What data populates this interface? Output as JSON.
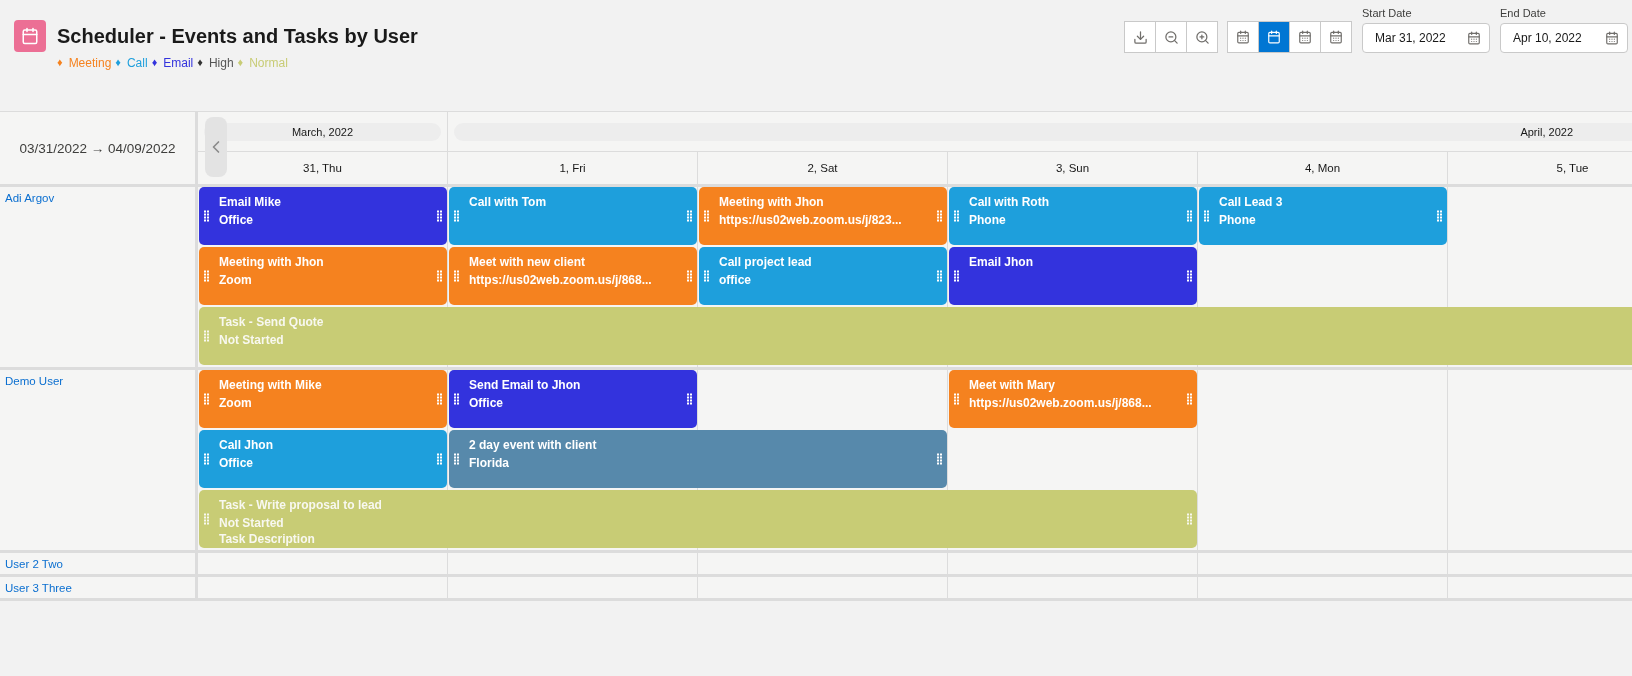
{
  "header": {
    "title": "Scheduler - Events and Tasks by User",
    "legend": [
      {
        "marker": "♦",
        "label": "Meeting",
        "color": "#f5821f"
      },
      {
        "marker": "♦",
        "label": "Call",
        "color": "#1e9fdc"
      },
      {
        "marker": "♦",
        "label": "Email",
        "color": "#3333dd"
      },
      {
        "marker": "♦",
        "label": "High",
        "color": "#333333"
      },
      {
        "marker": "♦",
        "label": "Normal",
        "color": "#c8cc75"
      }
    ]
  },
  "toolbar": {
    "actions": [
      {
        "kind": "download"
      },
      {
        "kind": "zoom-out"
      },
      {
        "kind": "zoom-in"
      }
    ],
    "views": [
      {
        "kind": "day",
        "selected": false
      },
      {
        "kind": "one",
        "selected": true
      },
      {
        "kind": "week",
        "selected": false
      },
      {
        "kind": "month",
        "selected": false
      }
    ],
    "start_date": {
      "label": "Start Date",
      "value": "Mar 31, 2022"
    },
    "end_date": {
      "label": "End Date",
      "value": "Apr 10, 2022"
    }
  },
  "scheduler": {
    "range": "03/31/2022 → 04/09/2022",
    "months": [
      "March, 2022",
      "April, 2022"
    ],
    "days": [
      "31, Thu",
      "1, Fri",
      "2, Sat",
      "3, Sun",
      "4, Mon",
      "5, Tue"
    ],
    "users": [
      {
        "name": "Adi Argov",
        "events": [
          {
            "kind": "email",
            "title": "Email Mike",
            "lines": [
              "Office"
            ]
          },
          {
            "kind": "call",
            "title": "Call with Tom"
          },
          {
            "kind": "meeting",
            "title": "Meeting with Jhon",
            "lines": [
              "https://us02web.zoom.us/j/823..."
            ]
          },
          {
            "kind": "call",
            "title": "Call with Roth",
            "lines": [
              "Phone"
            ]
          },
          {
            "kind": "call",
            "title": "Call Lead 3",
            "lines": [
              "Phone"
            ]
          },
          {
            "kind": "meeting",
            "title": "Meeting with Jhon",
            "lines": [
              "Zoom"
            ]
          },
          {
            "kind": "meeting",
            "title": "Meet with new client",
            "lines": [
              "https://us02web.zoom.us/j/868..."
            ]
          },
          {
            "kind": "call",
            "title": "Call project lead",
            "lines": [
              "office"
            ]
          },
          {
            "kind": "email",
            "title": "Email Jhon"
          },
          {
            "kind": "task",
            "title": "Task - Send Quote",
            "lines": [
              "Not Started"
            ]
          }
        ]
      },
      {
        "name": "Demo User",
        "events": [
          {
            "kind": "meeting",
            "title": "Meeting with Mike",
            "lines": [
              "Zoom"
            ]
          },
          {
            "kind": "email",
            "title": "Send Email to Jhon",
            "lines": [
              "Office"
            ]
          },
          {
            "kind": "meeting",
            "title": "Meet with Mary",
            "lines": [
              "https://us02web.zoom.us/j/868..."
            ]
          },
          {
            "kind": "call",
            "title": "Call Jhon",
            "lines": [
              "Office"
            ]
          },
          {
            "kind": "event",
            "title": "2 day event with client",
            "lines": [
              "Florida"
            ]
          },
          {
            "kind": "task",
            "title": "Task - Write proposal to lead",
            "lines": [
              "Not Started",
              "Task Description"
            ]
          }
        ]
      },
      {
        "name": "User 2 Two"
      },
      {
        "name": "User 3 Three"
      }
    ]
  }
}
